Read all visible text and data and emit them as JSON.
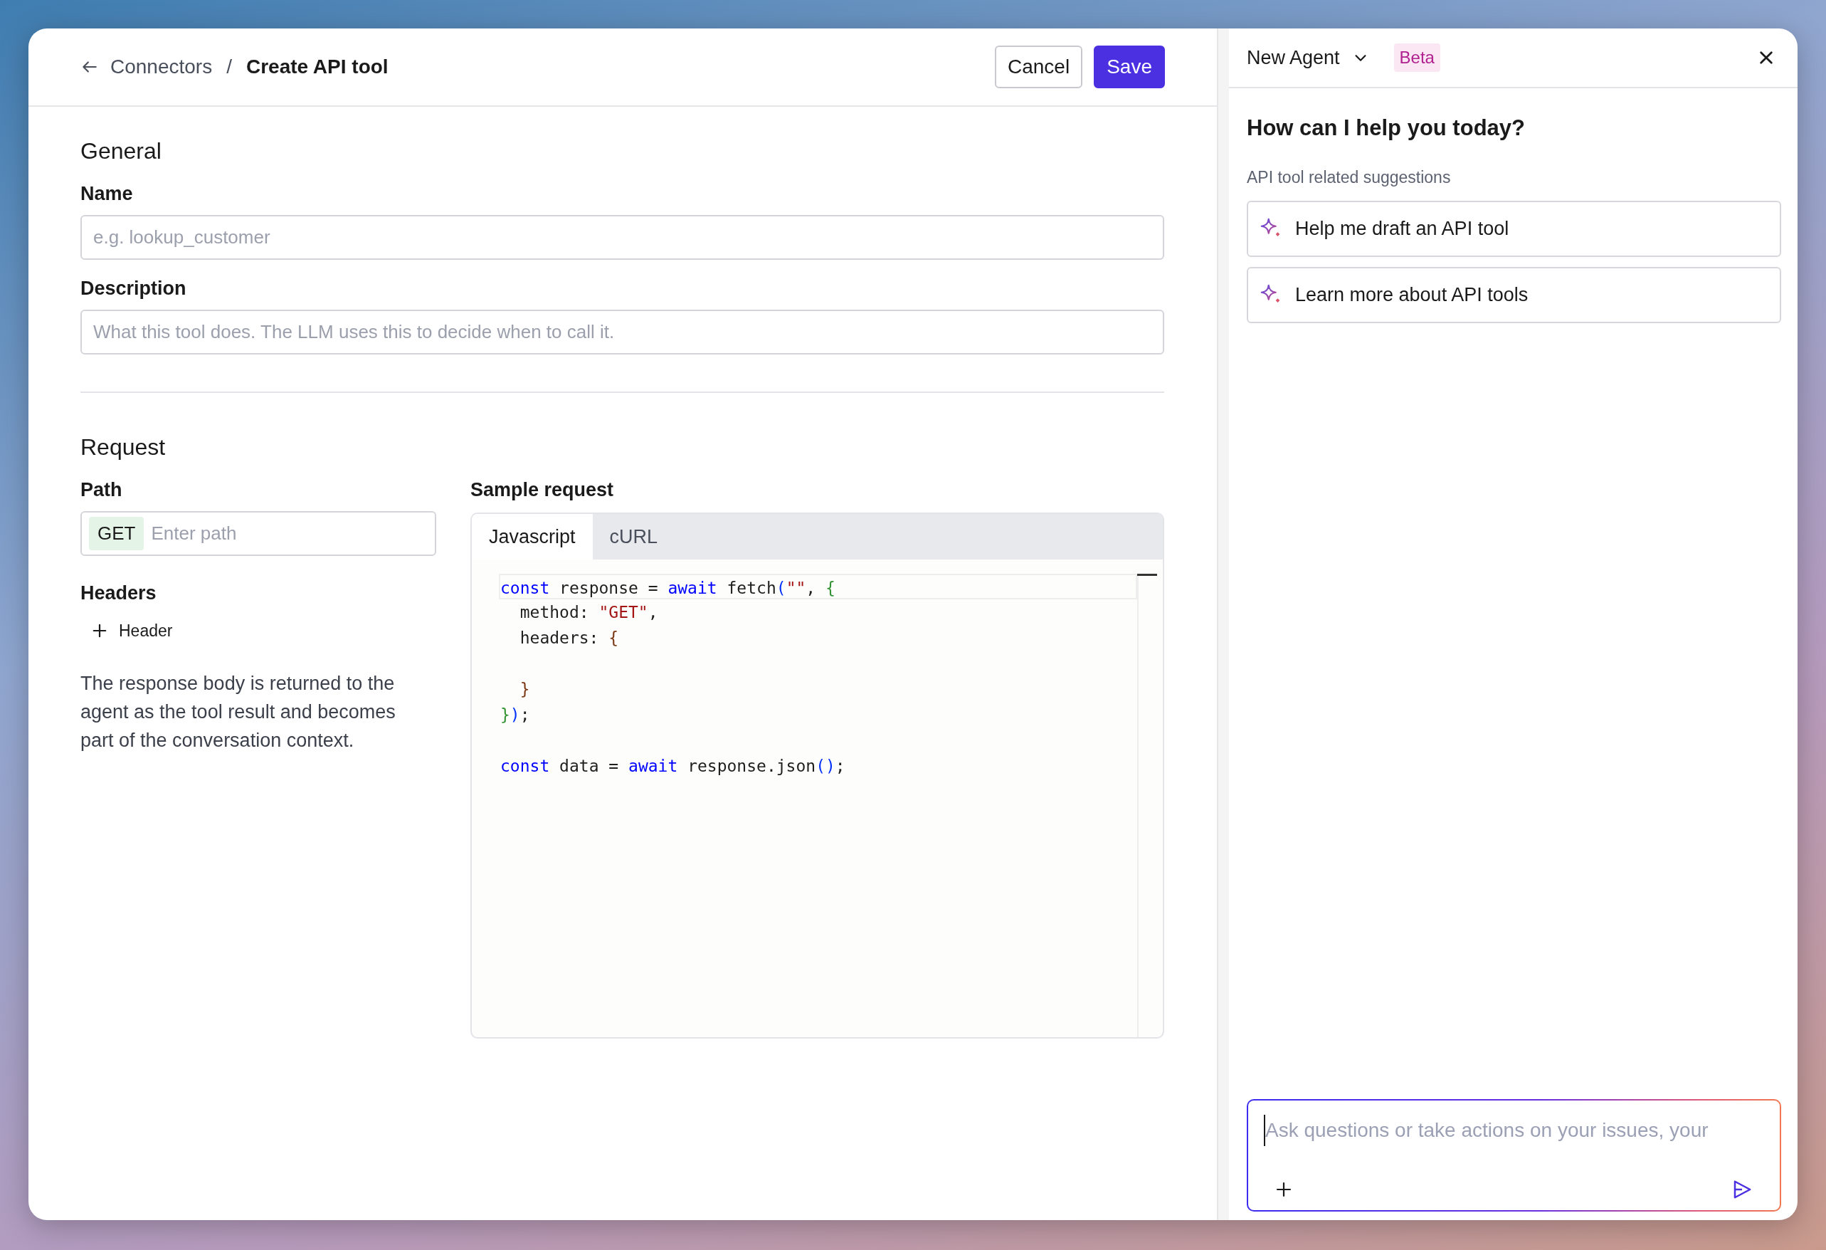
{
  "header": {
    "back_link": "Connectors",
    "separator": "/",
    "title": "Create API tool",
    "buttons": [
      {
        "label": "Cancel",
        "kind": "secondary"
      },
      {
        "label": "Save",
        "kind": "primary"
      }
    ]
  },
  "general": {
    "heading": "General",
    "fields": [
      {
        "label": "Name",
        "placeholder": "e.g. lookup_customer"
      },
      {
        "label": "Description",
        "placeholder": "What this tool does. The LLM uses this to decide when to call it."
      }
    ]
  },
  "request": {
    "heading": "Request",
    "path": {
      "label": "Path",
      "method": "GET",
      "placeholder": "Enter path"
    },
    "headers": {
      "label": "Headers",
      "add_label": "Header"
    },
    "note": "The response body is returned to the agent as the tool result and becomes part of the conversation context.",
    "sample": {
      "label": "Sample request",
      "tabs": [
        {
          "label": "Javascript",
          "selected": true
        },
        {
          "label": "cURL",
          "selected": false
        }
      ],
      "code": [
        {
          "kind": "code",
          "tokens": [
            {
              "kind": "keyword",
              "text": "const"
            },
            {
              "kind": "plain",
              "text": " response = "
            },
            {
              "kind": "keyword",
              "text": "await"
            },
            {
              "kind": "plain",
              "text": " fetch"
            },
            {
              "kind": "bracket1",
              "text": "("
            },
            {
              "kind": "string",
              "text": "\"\""
            },
            {
              "kind": "plain",
              "text": ", "
            },
            {
              "kind": "bracket2",
              "text": "{"
            }
          ]
        },
        {
          "kind": "code",
          "tokens": [
            {
              "kind": "plain",
              "text": "  method: "
            },
            {
              "kind": "string",
              "text": "\"GET\""
            },
            {
              "kind": "plain",
              "text": ","
            }
          ]
        },
        {
          "kind": "code",
          "tokens": [
            {
              "kind": "plain",
              "text": "  headers: "
            },
            {
              "kind": "bracket3",
              "text": "{"
            }
          ]
        },
        {
          "kind": "blank"
        },
        {
          "kind": "code",
          "tokens": [
            {
              "kind": "bracket3",
              "text": "  }"
            }
          ]
        },
        {
          "kind": "code",
          "tokens": [
            {
              "kind": "bracket2",
              "text": "}"
            },
            {
              "kind": "bracket1",
              "text": ")"
            },
            {
              "kind": "plain",
              "text": ";"
            }
          ]
        },
        {
          "kind": "blank"
        },
        {
          "kind": "code",
          "tokens": [
            {
              "kind": "keyword",
              "text": "const"
            },
            {
              "kind": "plain",
              "text": " data = "
            },
            {
              "kind": "keyword",
              "text": "await"
            },
            {
              "kind": "plain",
              "text": " response.json"
            },
            {
              "kind": "bracket1",
              "text": "()"
            },
            {
              "kind": "plain",
              "text": ";"
            }
          ]
        }
      ]
    }
  },
  "agent": {
    "name": "New Agent",
    "badge": "Beta",
    "greeting": "How can I help you today?",
    "suggestions_label": "API tool related suggestions",
    "suggestions": [
      "Help me draft an API tool",
      "Learn more about API tools"
    ],
    "composer": {
      "placeholder": "Ask questions or take actions on your issues, your"
    }
  }
}
